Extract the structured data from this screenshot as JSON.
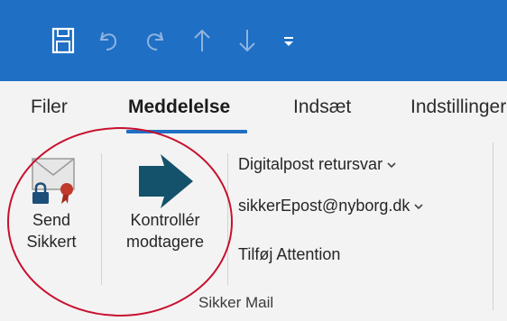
{
  "tabs": [
    {
      "label": "Filer"
    },
    {
      "label": "Meddelelse"
    },
    {
      "label": "Indsæt"
    },
    {
      "label": "Indstillinger"
    }
  ],
  "ribbon": {
    "send_secure": {
      "line1": "Send",
      "line2": "Sikkert"
    },
    "check_recipients": {
      "line1": "Kontrollér",
      "line2": "modtagere"
    },
    "digitalpost": "Digitalpost retursvar",
    "sender_address": "sikkerEpost@nyborg.dk",
    "add_attention": "Tilføj Attention",
    "group_label": "Sikker Mail"
  },
  "colors": {
    "title_bar": "#1f6fc4",
    "accent": "#1f6fc4",
    "arrow": "#13526a",
    "annotation": "#c8102e"
  },
  "icons": [
    "save-icon",
    "undo-icon",
    "redo-icon",
    "up-arrow-icon",
    "down-arrow-icon",
    "customize-qat-icon",
    "secure-envelope-icon",
    "forward-arrow-icon",
    "chevron-down-icon"
  ]
}
